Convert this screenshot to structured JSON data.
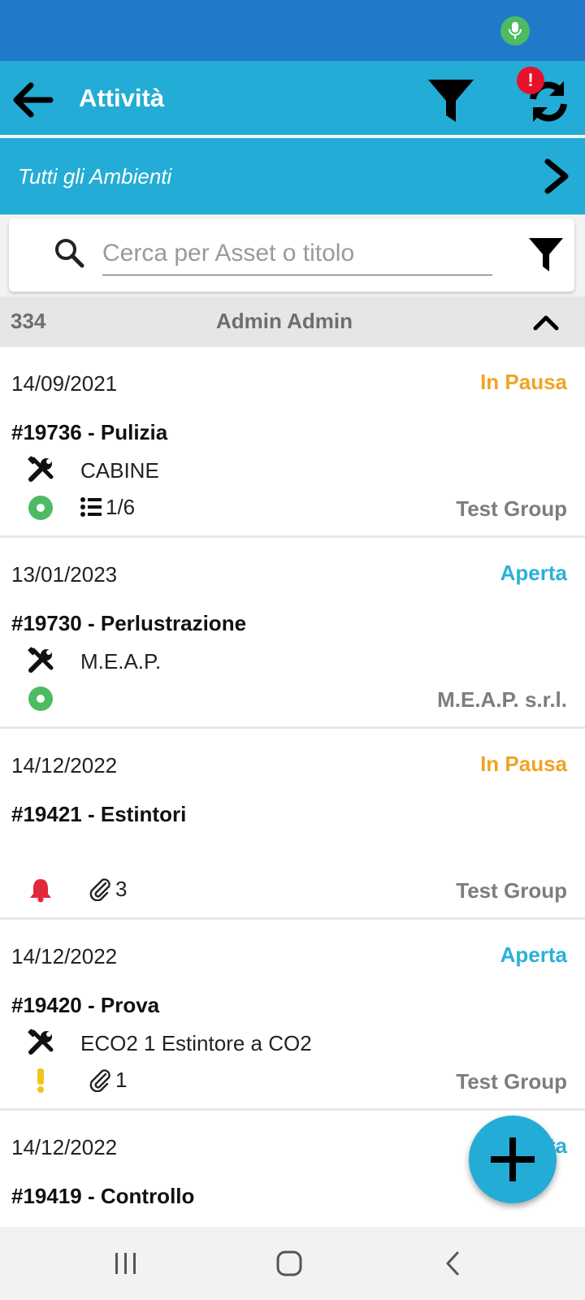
{
  "app_bar": {
    "title": "Attività",
    "alert_badge": "!"
  },
  "environment": {
    "label": "Tutti gli Ambienti"
  },
  "search": {
    "placeholder": "Cerca per Asset o titolo",
    "value": ""
  },
  "group": {
    "count": "334",
    "name": "Admin Admin"
  },
  "colors": {
    "primary": "#23acd6",
    "status_bar": "#2179c9",
    "status_paused": "#f0a424",
    "status_open": "#2cb0d9",
    "state_green": "#4cbb62",
    "bell_red": "#e3283c",
    "exclamation_yellow": "#f2c418"
  },
  "tasks": [
    {
      "date": "14/09/2021",
      "status": "In Pausa",
      "status_type": "paused",
      "title": "#19736 - Pulizia",
      "asset": "CABINE",
      "state_icon": "green-circle-icon",
      "extra_icon": "checklist-icon",
      "extra_text": "1/6",
      "group": "Test Group"
    },
    {
      "date": "13/01/2023",
      "status": "Aperta",
      "status_type": "open",
      "title": "#19730 - Perlustrazione",
      "asset": "M.E.A.P.",
      "state_icon": "green-circle-icon",
      "extra_icon": "",
      "extra_text": "",
      "group": "M.E.A.P. s.r.l."
    },
    {
      "date": "14/12/2022",
      "status": "In Pausa",
      "status_type": "paused",
      "title": "#19421 - Estintori",
      "asset": "",
      "state_icon": "bell-icon",
      "extra_icon": "paperclip-icon",
      "extra_text": "3",
      "group": "Test Group"
    },
    {
      "date": "14/12/2022",
      "status": "Aperta",
      "status_type": "open",
      "title": "#19420 - Prova",
      "asset": "ECO2 1 Estintore a CO2",
      "state_icon": "exclamation-icon",
      "extra_icon": "paperclip-icon",
      "extra_text": "1",
      "group": "Test Group"
    },
    {
      "date": "14/12/2022",
      "status": "Aperta",
      "status_type": "open",
      "title": "#19419 - Controllo",
      "asset": "",
      "state_icon": "",
      "extra_icon": "",
      "extra_text": "",
      "group": ""
    }
  ]
}
